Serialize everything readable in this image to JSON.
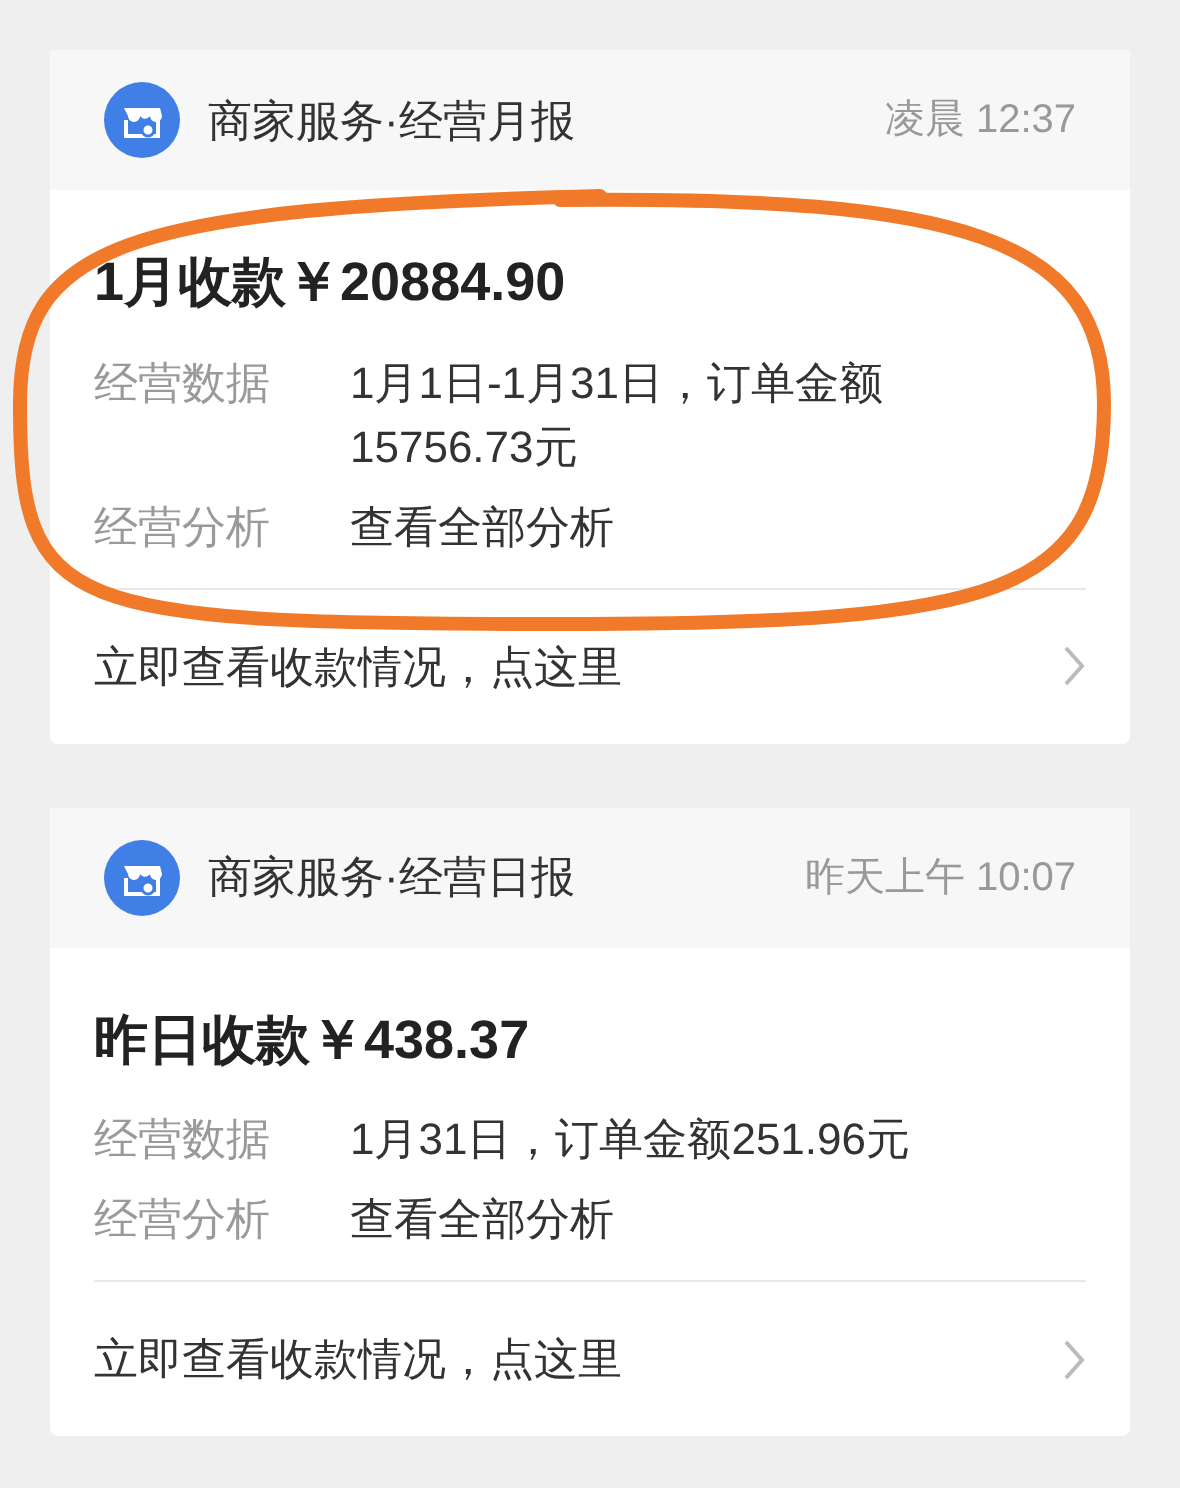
{
  "cards": [
    {
      "header": {
        "title": "商家服务·经营月报",
        "time": "凌晨 12:37"
      },
      "amount_title": "1月收款￥20884.90",
      "rows": [
        {
          "label": "经营数据",
          "value": "1月1日-1月31日，订单金额15756.73元"
        },
        {
          "label": "经营分析",
          "value": "查看全部分析"
        }
      ],
      "footer_link": "立即查看收款情况，点这里"
    },
    {
      "header": {
        "title": "商家服务·经营日报",
        "time": "昨天上午 10:07"
      },
      "amount_title": "昨日收款￥438.37",
      "rows": [
        {
          "label": "经营数据",
          "value": "1月31日，订单金额251.96元"
        },
        {
          "label": "经营分析",
          "value": "查看全部分析"
        }
      ],
      "footer_link": "立即查看收款情况，点这里"
    }
  ]
}
